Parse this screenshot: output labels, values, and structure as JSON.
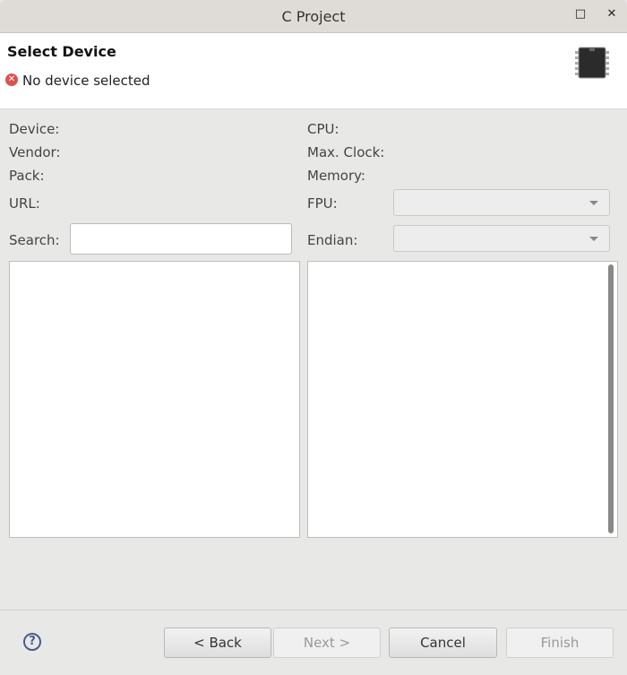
{
  "window": {
    "title": "C Project"
  },
  "header": {
    "title": "Select Device",
    "status": "No device selected"
  },
  "left_labels": {
    "device": "Device:",
    "vendor": "Vendor:",
    "pack": "Pack:",
    "url": "URL:",
    "search": "Search:"
  },
  "right_labels": {
    "cpu": "CPU:",
    "max_clock": "Max. Clock:",
    "memory": "Memory:",
    "fpu": "FPU:",
    "endian": "Endian:"
  },
  "search": {
    "value": ""
  },
  "buttons": {
    "back": "< Back",
    "next": "Next >",
    "cancel": "Cancel",
    "finish": "Finish"
  }
}
